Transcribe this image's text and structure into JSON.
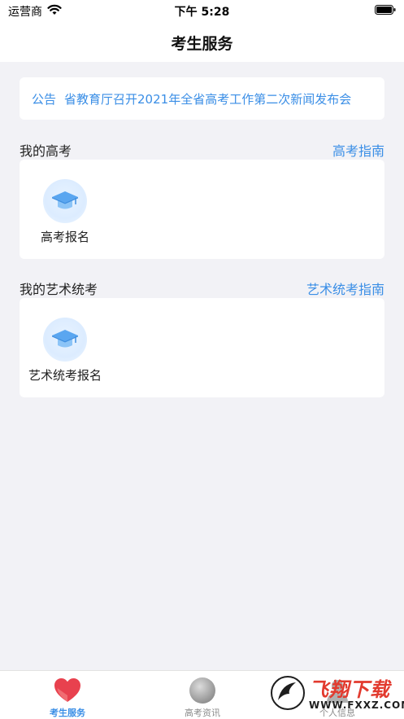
{
  "status_bar": {
    "carrier": "运营商",
    "time": "下午 5:28"
  },
  "nav": {
    "title": "考生服务"
  },
  "notice": {
    "label": "公告",
    "text": "省教育厅召开2021年全省高考工作第二次新闻发布会"
  },
  "sections": [
    {
      "title": "我的高考",
      "link": "高考指南",
      "tiles": [
        {
          "label": "高考报名",
          "icon": "graduation-cap-icon"
        }
      ]
    },
    {
      "title": "我的艺术统考",
      "link": "艺术统考指南",
      "tiles": [
        {
          "label": "艺术统考报名",
          "icon": "graduation-cap-icon"
        }
      ]
    }
  ],
  "tab_bar": {
    "tabs": [
      {
        "label": "考生服务",
        "icon": "heart-icon",
        "active": true
      },
      {
        "label": "高考资讯",
        "icon": "globe-icon",
        "active": false
      },
      {
        "label": "个人信息",
        "icon": "user-icon",
        "active": false
      }
    ]
  },
  "watermark": {
    "text": "飞翔下载",
    "url": "WWW.FXXZ.COM"
  },
  "colors": {
    "accent": "#3a8ee6",
    "background": "#f2f2f6",
    "heart": "#e8414e"
  }
}
